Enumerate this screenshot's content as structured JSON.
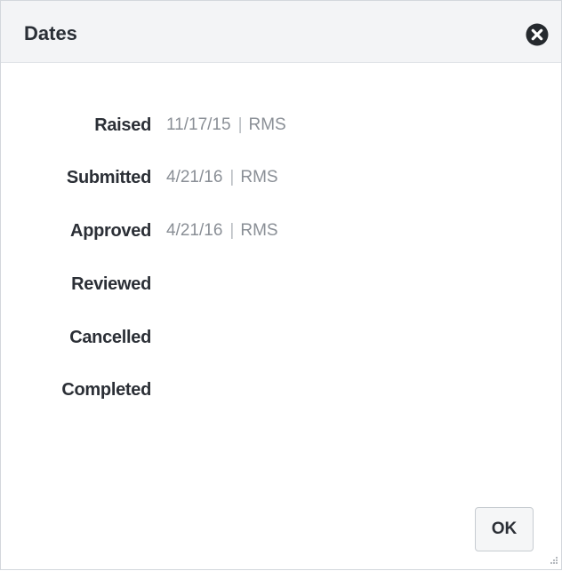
{
  "dialog": {
    "title": "Dates",
    "close_icon": "close-circle-icon",
    "ok_label": "OK"
  },
  "dates": [
    {
      "label": "Raised",
      "date": "11/17/15",
      "separator": "|",
      "user": "RMS"
    },
    {
      "label": "Submitted",
      "date": "4/21/16",
      "separator": "|",
      "user": "RMS"
    },
    {
      "label": "Approved",
      "date": "4/21/16",
      "separator": "|",
      "user": "RMS"
    },
    {
      "label": "Reviewed"
    },
    {
      "label": "Cancelled"
    },
    {
      "label": "Completed"
    }
  ],
  "colors": {
    "header_bg": "#f3f4f6",
    "label_text": "#2b2f36",
    "value_text": "#8a8f96"
  }
}
